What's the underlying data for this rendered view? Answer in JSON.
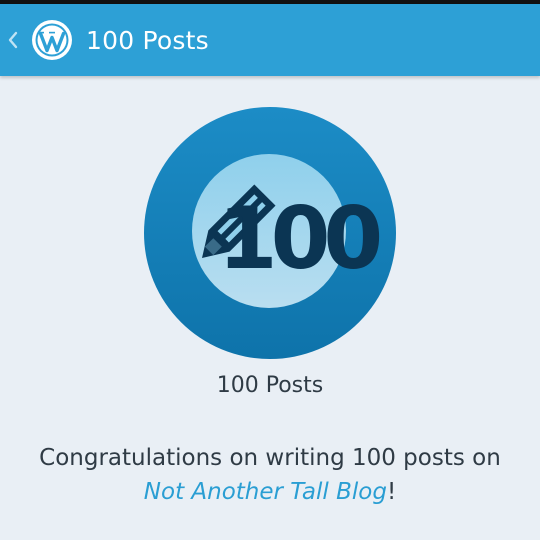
{
  "actionbar": {
    "title": "100 Posts",
    "back_icon": "chevron-left-icon",
    "logo_icon": "wordpress-logo-icon"
  },
  "badge": {
    "icon": "pencil-icon",
    "number": "100",
    "name": "100 Posts"
  },
  "description": {
    "prefix": "Congratulations on writing 100 posts on",
    "blog_name": "Not Another Tall Blog",
    "suffix": "!"
  },
  "colors": {
    "actionbar": "#2da0d6",
    "background": "#e9eff5",
    "badge_outer": "#1a86bf",
    "badge_inner": "#a3d5ee",
    "badge_glyph": "#0b3553",
    "link": "#2a9ed3",
    "text": "#2f3b45"
  }
}
